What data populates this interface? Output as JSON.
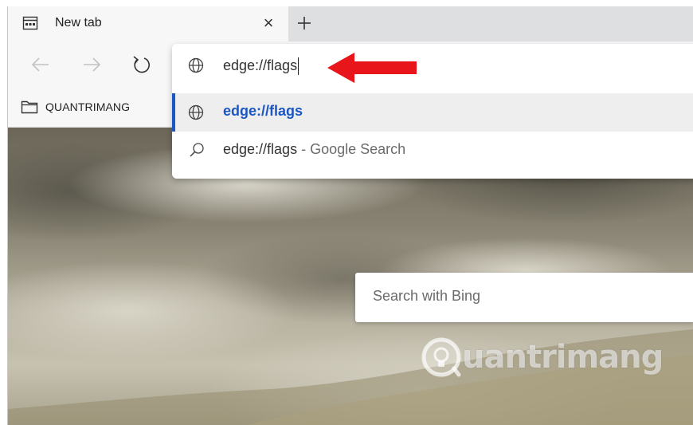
{
  "tab": {
    "title": "New tab",
    "close_glyph": "×",
    "icon": "new-tab-page-icon"
  },
  "toolbar": {
    "back_icon": "back-arrow-icon",
    "forward_icon": "forward-arrow-icon",
    "reload_icon": "reload-icon"
  },
  "favorites": {
    "items": [
      {
        "label": "QUANTRIMANG",
        "icon": "folder-icon"
      }
    ]
  },
  "address_bar": {
    "value": "edge://flags",
    "icon": "globe-icon"
  },
  "suggestions": [
    {
      "text": "edge://flags",
      "suffix": "",
      "icon": "globe-icon",
      "selected": true
    },
    {
      "text": "edge://flags",
      "suffix": " - Google Search",
      "icon": "search-icon",
      "selected": false
    }
  ],
  "page": {
    "search_placeholder": "Search with Bing",
    "watermark_text": "uantrimang"
  },
  "colors": {
    "accent": "#1a56c4",
    "annotation_arrow": "#e8151b",
    "chrome_bg": "#f7f7f7",
    "tabstrip_bg": "#dedfe1"
  }
}
